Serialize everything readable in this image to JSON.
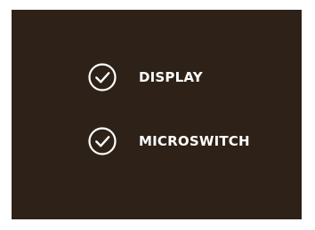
{
  "checklist": {
    "items": [
      {
        "label": "DISPLAY",
        "icon": "check-circle-icon",
        "checked": true
      },
      {
        "label": "MICROSWITCH",
        "icon": "check-circle-icon",
        "checked": true
      }
    ]
  },
  "colors": {
    "panel_background": "#2e2117",
    "foreground": "#ffffff"
  }
}
